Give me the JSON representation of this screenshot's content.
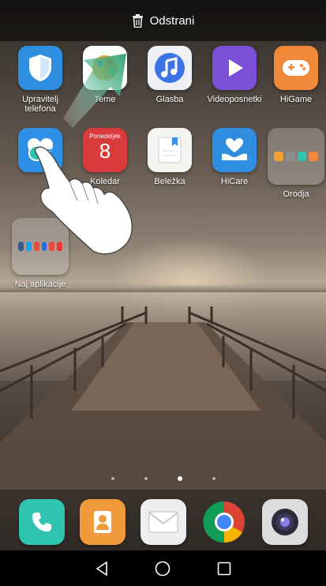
{
  "top_bar": {
    "action_label": "Odstrani",
    "icon": "trash-icon"
  },
  "apps": [
    {
      "key": "upravitelj",
      "label": "Upravitelj\ntelefona",
      "icon": "shield-icon",
      "color": "#2f8ee0"
    },
    {
      "key": "teme",
      "label": "Teme",
      "icon": "palette-icon",
      "color": "#f2a230"
    },
    {
      "key": "glasba",
      "label": "Glasba",
      "icon": "music-note-icon",
      "color": "#3c74e6"
    },
    {
      "key": "videoposnetki",
      "label": "Videoposnetki",
      "icon": "play-icon",
      "color": "#7b4fd6"
    },
    {
      "key": "higame",
      "label": "HiGame",
      "icon": "gamepad-icon",
      "color": "#f08a3a"
    },
    {
      "key": "zdravje",
      "label": "",
      "icon": "heart-icon",
      "color": "#2e8fe6"
    },
    {
      "key": "koledar",
      "label": "Koledar",
      "icon": "calendar-icon",
      "color": "#d93b3b",
      "day_name": "Ponedeljek",
      "day_number": "8"
    },
    {
      "key": "belezka",
      "label": "Beležka",
      "icon": "notepad-icon",
      "color": "#f4f4f0"
    },
    {
      "key": "hicare",
      "label": "HiCare",
      "icon": "hand-heart-icon",
      "color": "#2f8ee0"
    },
    {
      "key": "orodja",
      "label": "Orodja",
      "icon": "folder-icon",
      "color": "#9a9a9a"
    },
    {
      "key": "najaplikacije",
      "label": "Naj aplikacije",
      "icon": "folder-icon",
      "color": "#9a9a9a"
    }
  ],
  "page_indicator": {
    "count": 4,
    "active_index": 2
  },
  "dock": [
    {
      "key": "phone",
      "icon": "phone-icon",
      "color": "#2ec4b0"
    },
    {
      "key": "contacts",
      "icon": "contacts-icon",
      "color": "#f09a3c"
    },
    {
      "key": "messages",
      "icon": "envelope-icon",
      "color": "#eeeeee"
    },
    {
      "key": "chrome",
      "icon": "chrome-icon",
      "color": "#db4437"
    },
    {
      "key": "camera",
      "icon": "camera-icon",
      "color": "#dcdcdc"
    }
  ],
  "navbar": {
    "back": "back-icon",
    "home": "home-icon",
    "recents": "recents-icon"
  },
  "gesture": {
    "hand": "hand-pointer-icon",
    "arrow": "drag-arrow-icon"
  }
}
